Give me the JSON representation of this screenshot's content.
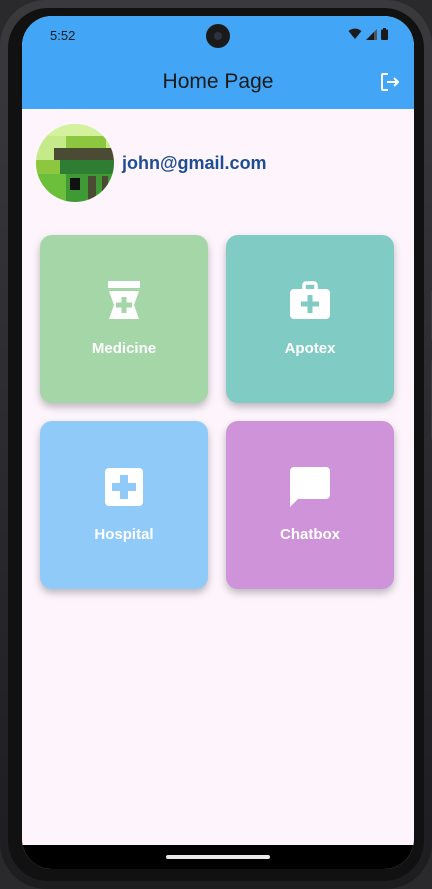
{
  "status_bar": {
    "time": "5:52"
  },
  "app_bar": {
    "title": "Home Page",
    "logout_icon": "logout-icon"
  },
  "profile": {
    "email": "john@gmail.com"
  },
  "tiles": [
    {
      "label": "Medicine",
      "icon": "medication-icon",
      "color": "#a5d6a7"
    },
    {
      "label": "Apotex",
      "icon": "medical-bag-icon",
      "color": "#80cbc4"
    },
    {
      "label": "Hospital",
      "icon": "hospital-cross-icon",
      "color": "#90caf9"
    },
    {
      "label": "Chatbox",
      "icon": "chat-bubble-icon",
      "color": "#ce93d8"
    }
  ],
  "colors": {
    "app_bar": "#42a5f5",
    "background": "#fdf4fc",
    "email_text": "#1e4e92"
  }
}
